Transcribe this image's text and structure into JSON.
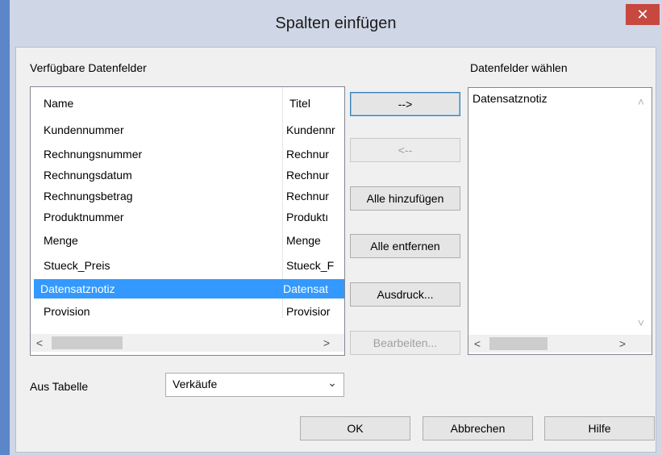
{
  "dialog": {
    "title": "Spalten einfügen",
    "close_glyph": "✕"
  },
  "available": {
    "label": "Verfügbare Datenfelder",
    "columns": [
      "Name",
      "Titel"
    ],
    "rows": [
      {
        "name": "Kundennummer",
        "title": "Kundennr"
      },
      {
        "name": "Rechnungsnummer",
        "title": "Rechnur"
      },
      {
        "name": "Rechnungsdatum",
        "title": "Rechnur"
      },
      {
        "name": "Rechnungsbetrag",
        "title": "Rechnur"
      },
      {
        "name": "Produktnummer",
        "title": "Produktı"
      },
      {
        "name": "Menge",
        "title": "Menge"
      },
      {
        "name": "Stueck_Preis",
        "title": "Stueck_F"
      },
      {
        "name": "Datensatznotiz",
        "title": "Datensat"
      },
      {
        "name": "Provision",
        "title": "Provisior"
      }
    ],
    "selected_row": "Datensatznotiz"
  },
  "chosen": {
    "label": "Datenfelder wählen",
    "items": [
      "Datensatznotiz"
    ]
  },
  "middle_buttons": {
    "add": "-->",
    "remove": "<--",
    "add_all": "Alle hinzufügen",
    "remove_all": "Alle entfernen",
    "expression": "Ausdruck...",
    "edit": "Bearbeiten..."
  },
  "table_select": {
    "label": "Aus Tabelle",
    "value": "Verkäufe"
  },
  "footer": {
    "ok": "OK",
    "cancel": "Abbrechen",
    "help": "Hilfe"
  },
  "scroll": {
    "left_arrow": "<",
    "right_arrow": ">",
    "up_arrow": "˄",
    "down_arrow": "˅",
    "combo_arrow": "⌄"
  },
  "colors": {
    "accent": "#5b86c9",
    "close": "#c7483f",
    "selection": "#3399ff"
  }
}
